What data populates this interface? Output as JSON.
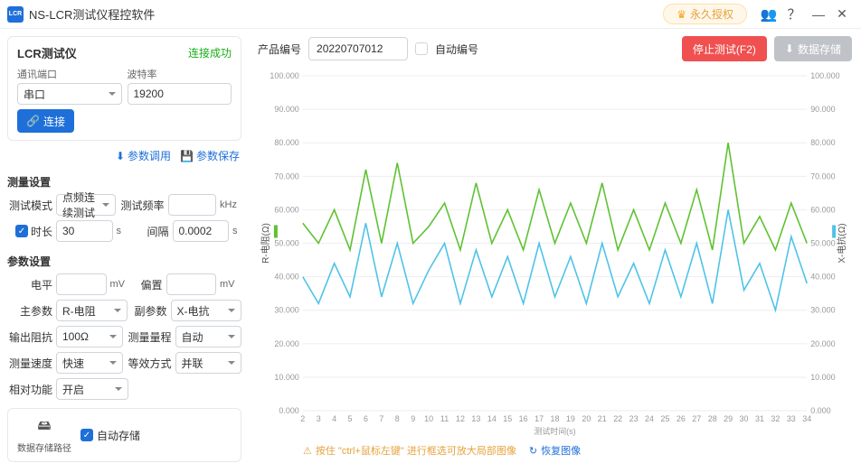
{
  "titlebar": {
    "app_name": "NS-LCR测试仪程控软件",
    "license": "永久授权",
    "icon_text": "LCR"
  },
  "side": {
    "device_card": {
      "title": "LCR测试仪",
      "status": "连接成功",
      "port_label": "通讯端口",
      "port_value": "串口",
      "baud_label": "波特率",
      "baud_value": "19200",
      "connect_btn": "连接"
    },
    "actions": {
      "param_apply": "参数调用",
      "param_save": "参数保存"
    },
    "meas": {
      "title": "测量设置",
      "mode_label": "测试模式",
      "mode_value": "点频连续测试",
      "freq_label": "测试频率",
      "freq_value": "",
      "freq_unit": "kHz",
      "duration_label": "时长",
      "duration_value": "30",
      "duration_unit": "s",
      "interval_label": "间隔",
      "interval_value": "0.0002",
      "interval_unit": "s"
    },
    "params": {
      "title": "参数设置",
      "level_label": "电平",
      "level_unit": "mV",
      "bias_label": "偏置",
      "bias_unit": "mV",
      "main_label": "主参数",
      "main_value": "R-电阻",
      "sub_label": "副参数",
      "sub_value": "X-电抗",
      "outimp_label": "输出阻抗",
      "outimp_value": "100Ω",
      "range_label": "测量量程",
      "range_value": "自动",
      "speed_label": "测量速度",
      "speed_value": "快速",
      "equiv_label": "等效方式",
      "equiv_value": "并联",
      "rel_label": "相对功能",
      "rel_value": "开启"
    },
    "storage": {
      "path_label": "数据存储路径",
      "autosave_label": "自动存储"
    }
  },
  "main": {
    "prodid_label": "产品编号",
    "prodid_value": "20220707012",
    "auto_id_label": "自动编号",
    "stop_btn": "停止测试(F2)",
    "save_btn": "数据存储",
    "hint_warn": "按住 \"ctrl+鼠标左键\" 进行框选可放大局部图像",
    "hint_restore": "恢复图像",
    "xlabel": "测试时间(s)"
  },
  "chart_data": {
    "type": "line",
    "title": "",
    "xlabel": "测试时间(s)",
    "y_left_label": "R-电阻(Ω)",
    "y_right_label": "X-电抗(Ω)",
    "ylim": [
      0,
      100000
    ],
    "x": [
      2,
      3,
      4,
      5,
      6,
      7,
      8,
      9,
      10,
      11,
      12,
      13,
      14,
      15,
      16,
      17,
      18,
      19,
      20,
      21,
      22,
      23,
      24,
      25,
      26,
      27,
      28,
      29,
      30,
      31,
      32,
      33,
      34
    ],
    "series": [
      {
        "name": "R-电阻(Ω)",
        "color": "#5ec232",
        "values": [
          56000,
          50000,
          60000,
          48000,
          72000,
          50000,
          74000,
          50000,
          55000,
          62000,
          48000,
          68000,
          50000,
          60000,
          48000,
          66000,
          50000,
          62000,
          50000,
          68000,
          48000,
          60000,
          48000,
          62000,
          50000,
          66000,
          48000,
          80000,
          50000,
          58000,
          48000,
          62000,
          50000
        ]
      },
      {
        "name": "X-电抗(Ω)",
        "color": "#4fc3e8",
        "values": [
          40000,
          32000,
          44000,
          34000,
          56000,
          34000,
          50000,
          32000,
          42000,
          50000,
          32000,
          48000,
          34000,
          46000,
          32000,
          50000,
          34000,
          46000,
          32000,
          50000,
          34000,
          44000,
          32000,
          48000,
          34000,
          50000,
          32000,
          60000,
          36000,
          44000,
          30000,
          52000,
          38000
        ]
      }
    ],
    "y_ticks": [
      0,
      10000,
      20000,
      30000,
      40000,
      50000,
      60000,
      70000,
      80000,
      90000,
      100000
    ],
    "y_tick_labels": [
      "0.000",
      "10.000",
      "20.000",
      "30.000",
      "40.000",
      "50.000",
      "60.000",
      "70.000",
      "80.000",
      "90.000",
      "100.000"
    ]
  }
}
